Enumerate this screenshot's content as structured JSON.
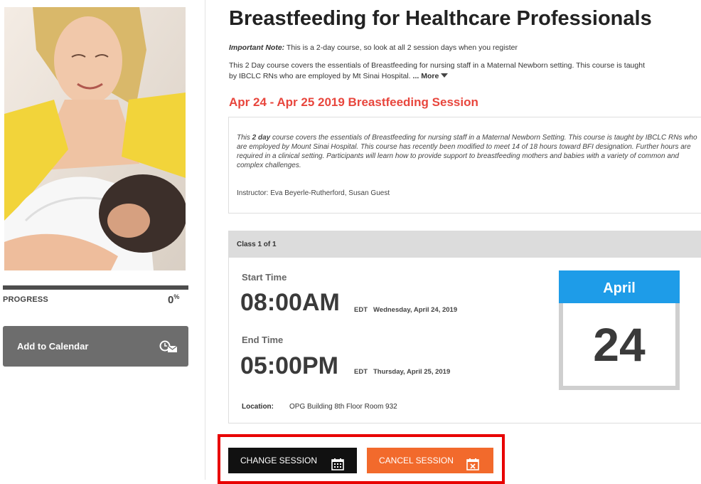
{
  "course": {
    "title": "Breastfeeding for Healthcare Professionals",
    "note_label": "Important Note:",
    "note_text": " This is a 2-day course, so look at all 2 session days when you register",
    "desc_line1": "This 2 Day course covers the essentials of Breastfeeding for nursing staff in a Maternal Newborn setting. This course is taught",
    "desc_line2": "by IBCLC RNs who are employed by Mt Sinai Hospital. ",
    "more_label": "... More"
  },
  "session": {
    "title": "Apr 24 - Apr 25 2019 Breastfeeding Session",
    "desc_pre": "This ",
    "desc_bold": "2 day",
    "desc_post": " course covers the essentials of Breastfeeding for nursing staff in a Maternal Newborn Setting. This course is taught by IBCLC RNs who are employed by Mount Sinai Hospital. This course has recently been modified to meet 14 of 18 hours toward BFI designation. Further hours are required in a clinical setting. Participants will learn how to provide support to breastfeeding mothers and babies with a variety of common and complex challenges.",
    "instructor": "Instructor: Eva Beyerle-Rutherford, Susan Guest"
  },
  "class": {
    "header": "Class 1 of 1",
    "start_label": "Start Time",
    "start_time": "08:00AM",
    "start_tz": "EDT",
    "start_day": "Wednesday, April 24, 2019",
    "end_label": "End Time",
    "end_time": "05:00PM",
    "end_tz": "EDT",
    "end_day": "Thursday, April 25, 2019",
    "location_label": "Location:",
    "location_value": "OPG Building 8th Floor Room 932",
    "cal_month": "April",
    "cal_day": "24"
  },
  "sidebar": {
    "progress_label": "PROGRESS",
    "progress_value": "0",
    "progress_unit": "%",
    "progress_fraction": 0,
    "add_calendar": "Add to Calendar"
  },
  "actions": {
    "change_session": "CHANGE SESSION",
    "cancel_session": "CANCEL SESSION"
  },
  "colors": {
    "accent_red": "#e8463d",
    "calendar_blue": "#1e9ce8",
    "cancel_orange": "#f26a2c",
    "highlight_red": "#e80000"
  }
}
